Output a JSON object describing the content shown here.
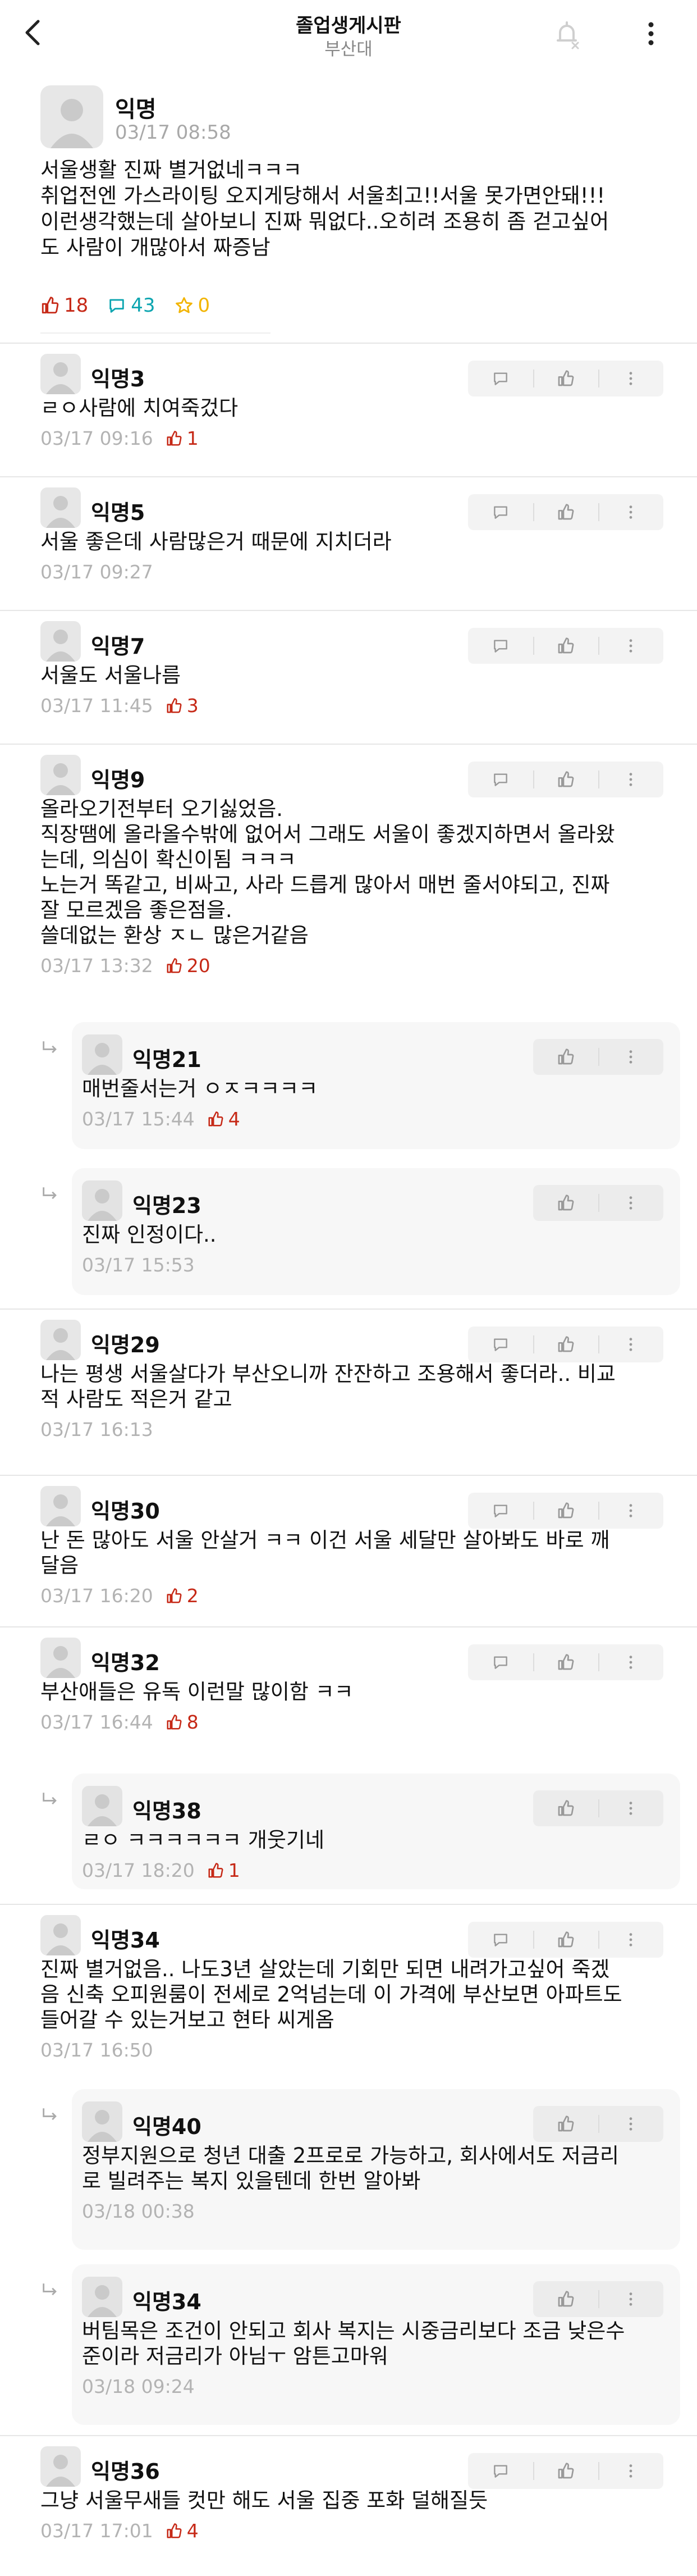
{
  "header": {
    "title": "졸업생게시판",
    "subtitle": "부산대"
  },
  "post": {
    "author": "익명",
    "time": "03/17 08:58",
    "lines": [
      "서울생활 진짜 별거없네ㅋㅋㅋ",
      "취업전엔 가스라이팅 오지게당해서 서울최고!!서울 못가면안돼!!!",
      "이런생각했는데 살아보니 진짜 뭐없다..오히려 조용히 좀 걷고싶어",
      "도 사람이 개많아서 짜증남"
    ],
    "likes": "18",
    "comments": "43",
    "scraps": "0"
  },
  "comments": [
    {
      "author": "익명3",
      "lines": [
        "ㄹㅇ사람에 치여죽겄다"
      ],
      "time": "03/17 09:16",
      "likes": "1"
    },
    {
      "author": "익명5",
      "lines": [
        "서울 좋은데 사람많은거 때문에 지치더라"
      ],
      "time": "03/17 09:27",
      "likes": ""
    },
    {
      "author": "익명7",
      "lines": [
        "서울도 서울나름"
      ],
      "time": "03/17 11:45",
      "likes": "3"
    },
    {
      "author": "익명9",
      "lines": [
        "올라오기전부터 오기싫었음.",
        "직장땜에 올라올수밖에 없어서 그래도 서울이 좋겠지하면서 올라왔",
        "는데, 의심이 확신이됨 ㅋㅋㅋ",
        "노는거 똑같고, 비싸고, 사라 드릅게 많아서 매번 줄서야되고, 진짜",
        "잘 모르겠음 좋은점을.",
        "쓸데없는 환상 ㅈㄴ 많은거같음"
      ],
      "time": "03/17 13:32",
      "likes": "20"
    },
    {
      "author": "익명21",
      "lines": [
        "매번줄서는거 ㅇㅈㅋㅋㅋㅋ"
      ],
      "time": "03/17 15:44",
      "likes": "4"
    },
    {
      "author": "익명23",
      "lines": [
        "진짜 인정이다.."
      ],
      "time": "03/17 15:53",
      "likes": ""
    },
    {
      "author": "익명29",
      "lines": [
        "나는 평생 서울살다가 부산오니까 잔잔하고 조용해서 좋더라.. 비교",
        "적 사람도 적은거 같고"
      ],
      "time": "03/17 16:13",
      "likes": ""
    },
    {
      "author": "익명30",
      "lines": [
        "난 돈 많아도 서울 안살거 ㅋㅋ 이건 서울 세달만 살아봐도 바로 깨",
        "달음"
      ],
      "time": "03/17 16:20",
      "likes": "2"
    },
    {
      "author": "익명32",
      "lines": [
        "부산애들은 유독 이런말 많이함 ㅋㅋ"
      ],
      "time": "03/17 16:44",
      "likes": "8"
    },
    {
      "author": "익명38",
      "lines": [
        "ㄹㅇ ㅋㅋㅋㅋㅋㅋ 개웃기네"
      ],
      "time": "03/17 18:20",
      "likes": "1"
    },
    {
      "author": "익명34",
      "lines": [
        "진짜 별거없음.. 나도3년 살았는데 기회만 되면 내려가고싶어 죽겠",
        "음 신축 오피원룸이 전세로 2억넘는데 이 가격에 부산보면 아파트도",
        "들어갈 수 있는거보고 현타 씨게옴"
      ],
      "time": "03/17 16:50",
      "likes": ""
    },
    {
      "author": "익명40",
      "lines": [
        "정부지원으로 청년 대출 2프로로 가능하고, 회사에서도 저금리",
        "로 빌려주는 복지 있을텐데 한번 알아봐"
      ],
      "time": "03/18 00:38",
      "likes": ""
    },
    {
      "author": "익명34",
      "lines": [
        "버팀목은 조건이 안되고 회사 복지는 시중금리보다 조금 낮은수",
        "준이라 저금리가 아님ㅜ 암튼고마워"
      ],
      "time": "03/18 09:24",
      "likes": ""
    },
    {
      "author": "익명36",
      "lines": [
        "그냥 서울무새들 컷만 해도 서울 집중 포화 덜해질듯"
      ],
      "time": "03/17 17:01",
      "likes": "4"
    }
  ],
  "icons": {
    "back": "back-arrow-icon",
    "bell": "bell-off-icon",
    "more": "more-vertical-icon",
    "like": "thumbs-up-icon",
    "comment": "speech-bubble-icon",
    "scrap": "star-icon",
    "reply": "reply-arrow-icon"
  },
  "colors": {
    "like": "#c62917",
    "comment": "#0ca5b0",
    "scrap": "#f2b400",
    "muted": "#a8a8a8",
    "reply_bg": "#f7f7f7"
  }
}
